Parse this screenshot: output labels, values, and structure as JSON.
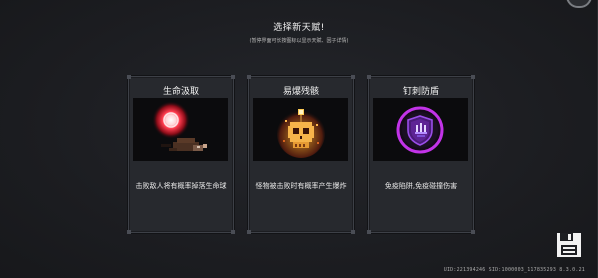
{
  "header": {
    "title": "选择新天赋!",
    "subtitle": "(暂停界面可长按图标以显示天赋、因子详情)"
  },
  "talents": [
    {
      "name": "生命汲取",
      "description": "击败敌人将有概率掉落生命球",
      "art": "life-orb-icon"
    },
    {
      "name": "易爆残骸",
      "description": "怪物被击败时有概率产生爆炸",
      "art": "burning-skull-icon"
    },
    {
      "name": "钉刺防盾",
      "description": "免疫陷阱,免疫碰撞伤害",
      "art": "spiked-shield-icon"
    }
  ],
  "footer": {
    "ids": "UID:221394246 SID:1000003_117835293 8.3.0.21"
  },
  "colors": {
    "background": "#1d1e22",
    "card": "#27292e",
    "shield_ring": "#c233e8",
    "orb": "#ff3a4a",
    "flame": "#f49b2a"
  }
}
